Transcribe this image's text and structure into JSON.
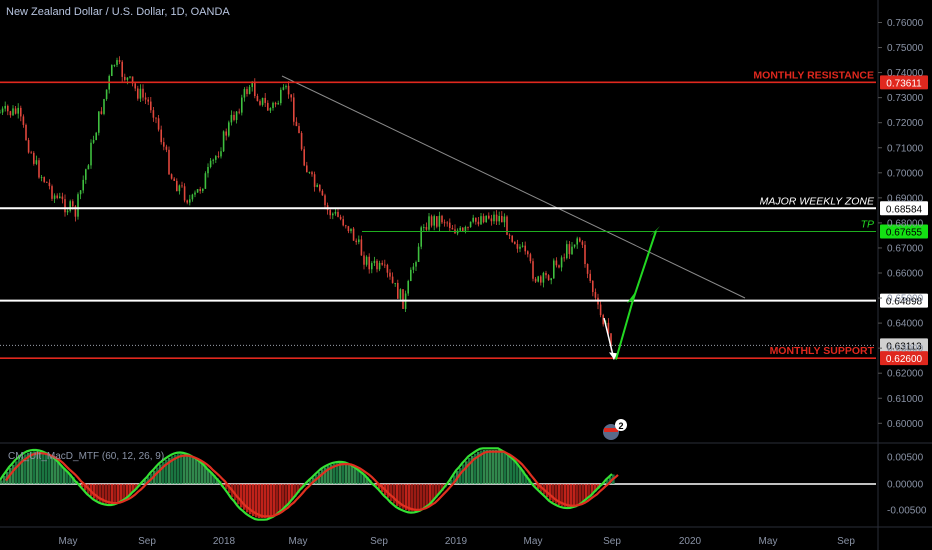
{
  "symbol_title": "New Zealand Dollar / U.S. Dollar, 1D, OANDA",
  "indicator_title": "CM_Ult_MacD_MTF (60, 12, 26, 9)",
  "colors": {
    "background": "#000000",
    "up_candle": "#3fbf3f",
    "down_candle": "#e0473c",
    "resistance": "#e0281e",
    "support": "#e0281e",
    "zone": "#ffffff",
    "tp": "#1fae1f",
    "arrow": "#22d822",
    "trendline": "#8a8a8a",
    "axis_text": "#8a93a6"
  },
  "levels": [
    {
      "key": "monthly_resistance",
      "label": "MONTHLY RESISTANCE",
      "price_label": "0.73611",
      "value": 0.73611
    },
    {
      "key": "major_weekly_zone",
      "label": "MAJOR WEEKLY ZONE",
      "price_label": "0.68584",
      "value": 0.68584
    },
    {
      "key": "tp",
      "label": "TP",
      "price_label": "0.67655",
      "value": 0.67655
    },
    {
      "key": "level_064898",
      "label": "",
      "price_label": "0.64898",
      "value": 0.64898
    },
    {
      "key": "current",
      "label": "",
      "price_label": "0.63113",
      "value": 0.63113
    },
    {
      "key": "monthly_support",
      "label": "MONTHLY SUPPORT",
      "price_label": "0.62600",
      "value": 0.626
    }
  ],
  "macd_badge": "2",
  "chart_data": {
    "type": "candlestick",
    "title": "New Zealand Dollar / U.S. Dollar, 1D, OANDA",
    "price_axis": {
      "range": [
        0.59,
        0.765
      ],
      "ticks": [
        "0.76000",
        "0.75000",
        "0.74000",
        "0.73000",
        "0.72000",
        "0.71000",
        "0.70000",
        "0.69000",
        "0.68000",
        "0.67000",
        "0.66000",
        "0.65000",
        "0.64000",
        "0.63000",
        "0.62000",
        "0.61000",
        "0.60000"
      ]
    },
    "time_axis": {
      "ticks": [
        "May",
        "Sep",
        "2018",
        "May",
        "Sep",
        "2019",
        "May",
        "Sep",
        "2020",
        "May",
        "Sep"
      ]
    },
    "price_path": [
      {
        "date": "2017-02",
        "value": 0.724
      },
      {
        "date": "2017-03",
        "value": 0.702
      },
      {
        "date": "2017-04",
        "value": 0.69
      },
      {
        "date": "2017-05",
        "value": 0.684
      },
      {
        "date": "2017-06",
        "value": 0.716
      },
      {
        "date": "2017-07",
        "value": 0.744
      },
      {
        "date": "2017-08",
        "value": 0.734
      },
      {
        "date": "2017-09",
        "value": 0.726
      },
      {
        "date": "2017-10",
        "value": 0.698
      },
      {
        "date": "2017-11",
        "value": 0.688
      },
      {
        "date": "2017-12",
        "value": 0.702
      },
      {
        "date": "2018-01",
        "value": 0.72
      },
      {
        "date": "2018-02",
        "value": 0.735
      },
      {
        "date": "2018-03",
        "value": 0.725
      },
      {
        "date": "2018-04",
        "value": 0.733
      },
      {
        "date": "2018-05",
        "value": 0.7
      },
      {
        "date": "2018-06",
        "value": 0.685
      },
      {
        "date": "2018-07",
        "value": 0.68
      },
      {
        "date": "2018-08",
        "value": 0.665
      },
      {
        "date": "2018-09",
        "value": 0.66
      },
      {
        "date": "2018-10",
        "value": 0.648
      },
      {
        "date": "2018-11",
        "value": 0.68
      },
      {
        "date": "2018-12",
        "value": 0.682
      },
      {
        "date": "2019-01",
        "value": 0.675
      },
      {
        "date": "2019-02",
        "value": 0.683
      },
      {
        "date": "2019-03",
        "value": 0.682
      },
      {
        "date": "2019-04",
        "value": 0.67
      },
      {
        "date": "2019-05",
        "value": 0.655
      },
      {
        "date": "2019-06",
        "value": 0.665
      },
      {
        "date": "2019-07",
        "value": 0.675
      },
      {
        "date": "2019-08",
        "value": 0.645
      },
      {
        "date": "2019-09",
        "value": 0.628
      }
    ],
    "macd_axis": {
      "ticks": [
        "0.00500",
        "0.00000",
        "-0.00500"
      ]
    },
    "grid": false
  }
}
